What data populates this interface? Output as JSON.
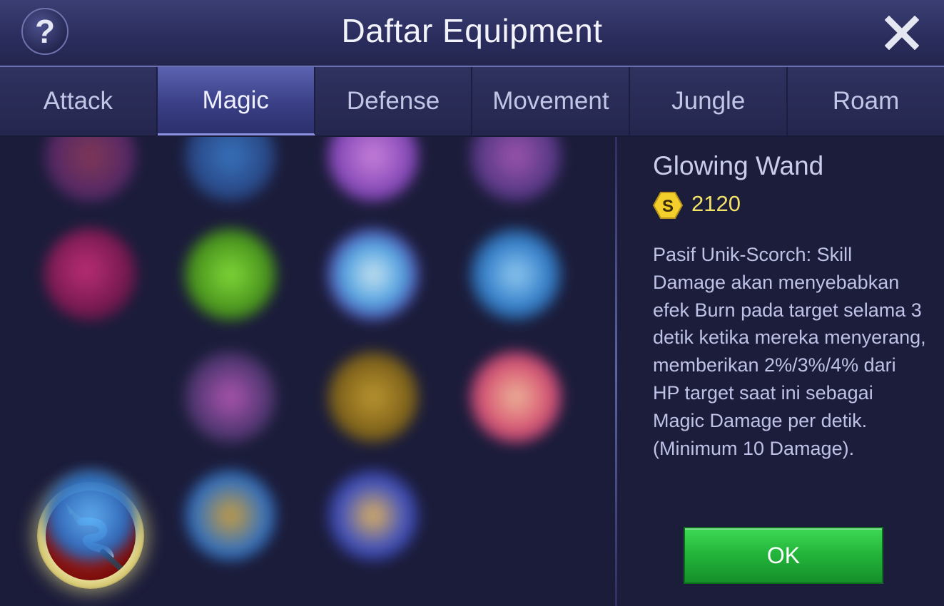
{
  "header": {
    "title": "Daftar Equipment",
    "help_label": "?"
  },
  "tabs": [
    {
      "label": "Attack",
      "active": false
    },
    {
      "label": "Magic",
      "active": true
    },
    {
      "label": "Defense",
      "active": false
    },
    {
      "label": "Movement",
      "active": false
    },
    {
      "label": "Jungle",
      "active": false
    },
    {
      "label": "Roam",
      "active": false
    }
  ],
  "detail": {
    "item_name": "Glowing Wand",
    "currency_symbol": "S",
    "price": "2120",
    "description": "Pasif Unik-Scorch: Skill Damage akan menyebabkan efek Burn pada target selama 3 detik ketika mereka menyerang, memberikan 2%/3%/4% dari HP target saat ini sebagai Magic Damage per detik. (Minimum 10 Damage).",
    "ok_label": "OK"
  },
  "colors": {
    "accent_gold": "#f2e268",
    "ok_green": "#22b33a",
    "active_tab": "#3a3f86"
  }
}
